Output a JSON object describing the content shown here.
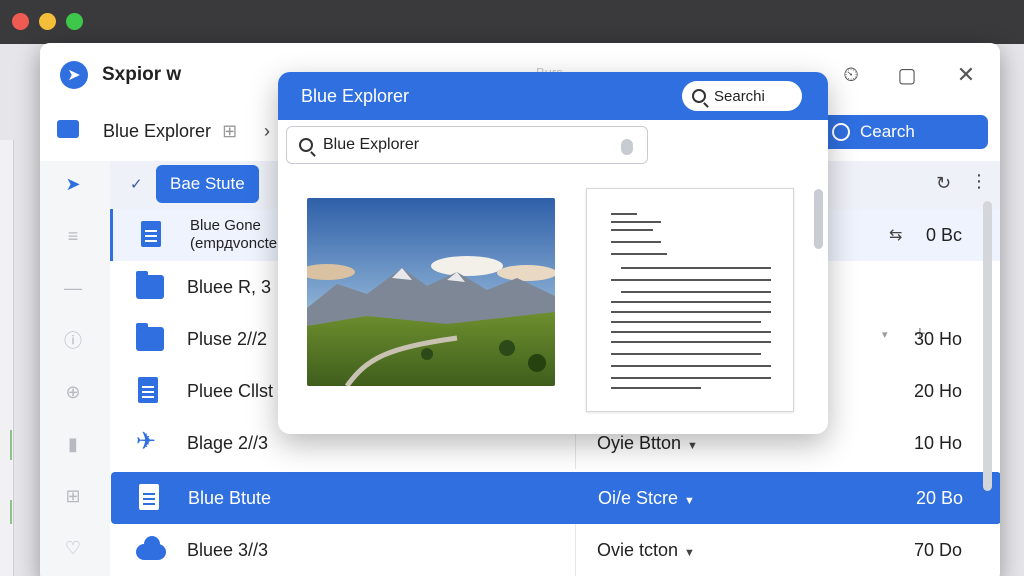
{
  "app": {
    "title": "Sxpior w",
    "path": "Blue Explorer",
    "path_suffix": "⊞",
    "search_button": "Cearch"
  },
  "toolbar_ghost": [
    "Burs"
  ],
  "list": {
    "header_toggle": "✓",
    "header_pill": "Bae Stute",
    "rows": [
      {
        "name_line1": "Blue Gone",
        "name_line2": "(empдvoncte",
        "kind": "",
        "size": "0 Bc",
        "icon": "doc-icon"
      },
      {
        "name": "Bluee R,  3",
        "kind": "",
        "size": "",
        "icon": "folder-icon"
      },
      {
        "name": "Pluse 2//2",
        "kind": "",
        "size": "30 Ho",
        "icon": "folder-icon"
      },
      {
        "name": "Pluee Cllst",
        "kind": "",
        "size": "20 Ho",
        "icon": "doc-icon"
      },
      {
        "name": "Blage 2//3",
        "kind": "Oyie Btton",
        "size": "10 Ho",
        "icon": "plane-icon"
      },
      {
        "name": "Blue Btute",
        "kind": "Oi/e Stcre",
        "size": "20 Bo",
        "icon": "doc-icon"
      },
      {
        "name": "Bluee 3//3",
        "kind": "Ovie tcton",
        "size": "70 Do",
        "icon": "cloud-icon"
      }
    ]
  },
  "popup": {
    "title": "Blue Explorer",
    "search_button": "Searchi",
    "search_value": "Blue Explorer"
  },
  "colors": {
    "accent": "#2f6fe0",
    "selected_row": "#2f6fe0",
    "header_bg": "#eef1f8"
  }
}
